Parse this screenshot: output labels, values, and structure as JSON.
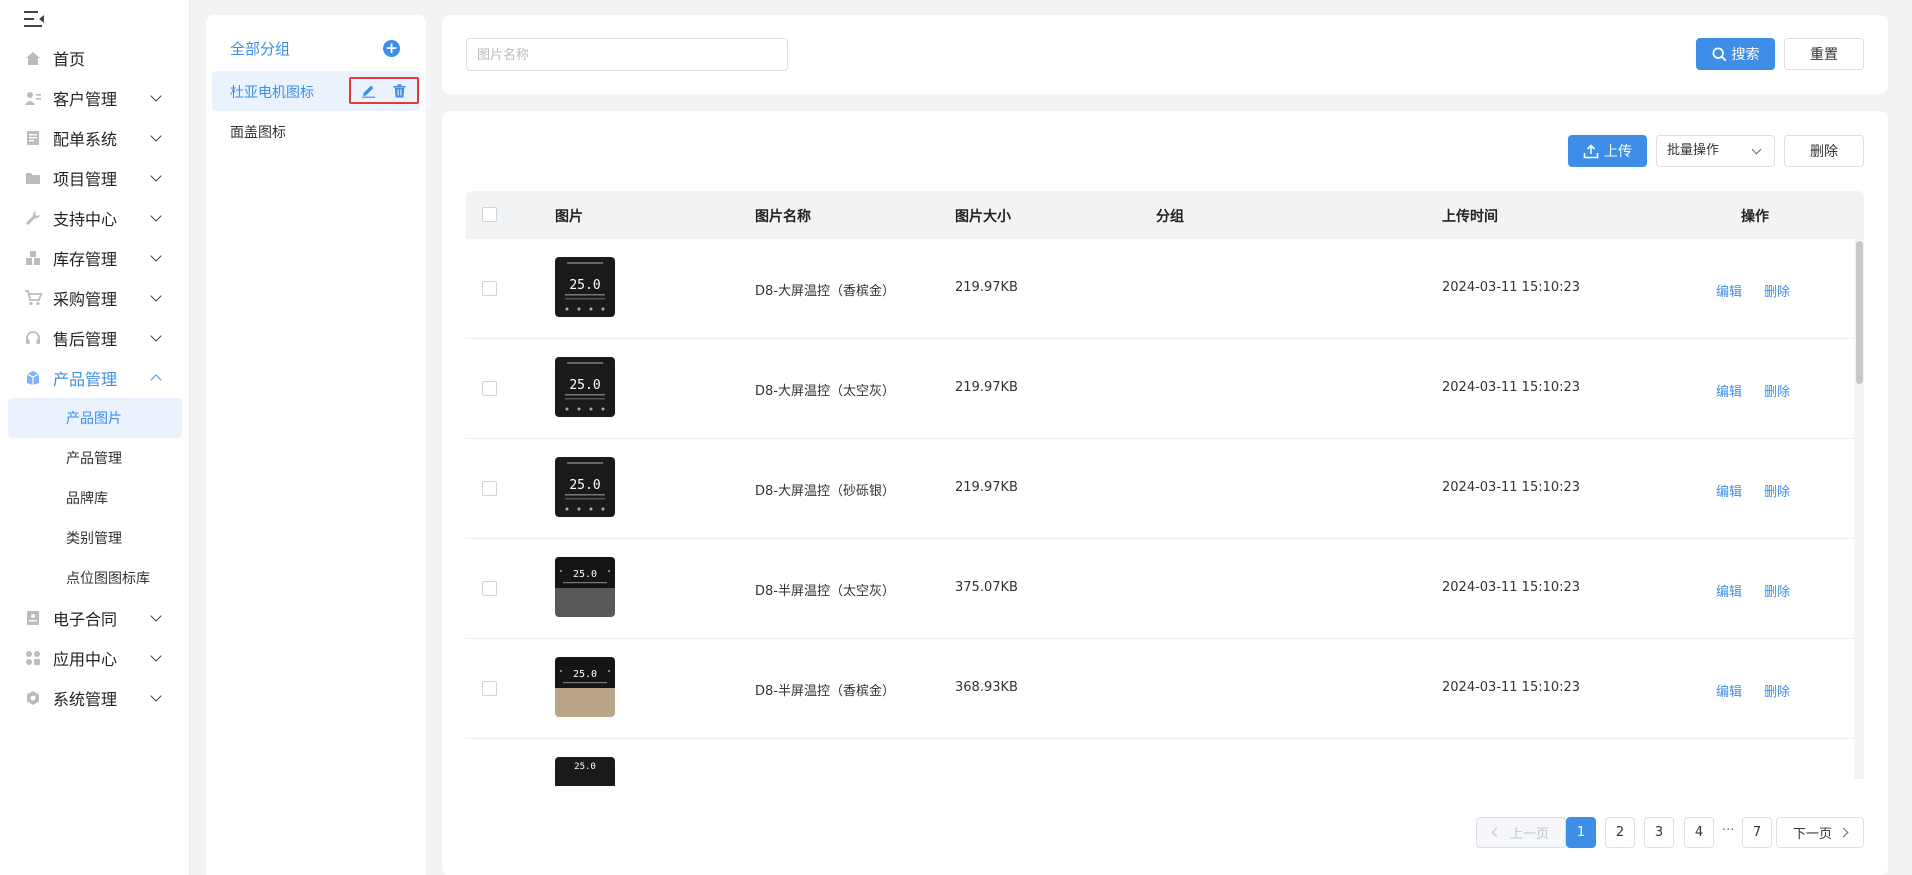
{
  "sidebar": {
    "items": [
      {
        "label": "首页",
        "icon": "home-icon"
      },
      {
        "label": "客户管理",
        "icon": "customer-icon"
      },
      {
        "label": "配单系统",
        "icon": "order-icon"
      },
      {
        "label": "项目管理",
        "icon": "folder-icon"
      },
      {
        "label": "支持中心",
        "icon": "wrench-icon"
      },
      {
        "label": "库存管理",
        "icon": "inventory-icon"
      },
      {
        "label": "采购管理",
        "icon": "cart-icon"
      },
      {
        "label": "售后管理",
        "icon": "headset-icon"
      },
      {
        "label": "产品管理",
        "icon": "box-icon"
      },
      {
        "label": "电子合同",
        "icon": "contract-icon"
      },
      {
        "label": "应用中心",
        "icon": "apps-icon"
      },
      {
        "label": "系统管理",
        "icon": "settings-icon"
      }
    ],
    "product_sub": [
      "产品图片",
      "产品管理",
      "品牌库",
      "类别管理",
      "点位图图标库"
    ]
  },
  "groups": {
    "all_label": "全部分组",
    "items": [
      "杜亚电机图标",
      "面盖图标"
    ]
  },
  "search": {
    "placeholder": "图片名称",
    "search_label": "搜索",
    "reset_label": "重置"
  },
  "toolbar": {
    "upload_label": "上传",
    "batch_label": "批量操作",
    "delete_label": "删除"
  },
  "table": {
    "headers": [
      "图片",
      "图片名称",
      "图片大小",
      "分组",
      "上传时间",
      "操作"
    ],
    "rows": [
      {
        "name": "D8-大屏温控（香槟金）",
        "size": "219.97KB",
        "group": "",
        "time": "2024-03-11 15:10:23",
        "edit": "编辑",
        "delete": "删除"
      },
      {
        "name": "D8-大屏温控（太空灰）",
        "size": "219.97KB",
        "group": "",
        "time": "2024-03-11 15:10:23",
        "edit": "编辑",
        "delete": "删除"
      },
      {
        "name": "D8-大屏温控（砂砾银）",
        "size": "219.97KB",
        "group": "",
        "time": "2024-03-11 15:10:23",
        "edit": "编辑",
        "delete": "删除"
      },
      {
        "name": "D8-半屏温控（太空灰）",
        "size": "375.07KB",
        "group": "",
        "time": "2024-03-11 15:10:23",
        "edit": "编辑",
        "delete": "删除"
      },
      {
        "name": "D8-半屏温控（香槟金）",
        "size": "368.93KB",
        "group": "",
        "time": "2024-03-11 15:10:23",
        "edit": "编辑",
        "delete": "删除"
      }
    ]
  },
  "pagination": {
    "prev": "上一页",
    "pages": [
      "1",
      "2",
      "3",
      "4"
    ],
    "ellipsis": "···",
    "last": "7",
    "next": "下一页",
    "current": "1"
  },
  "colors": {
    "accent": "#3e8ee8",
    "highlight_border": "#e53935"
  }
}
